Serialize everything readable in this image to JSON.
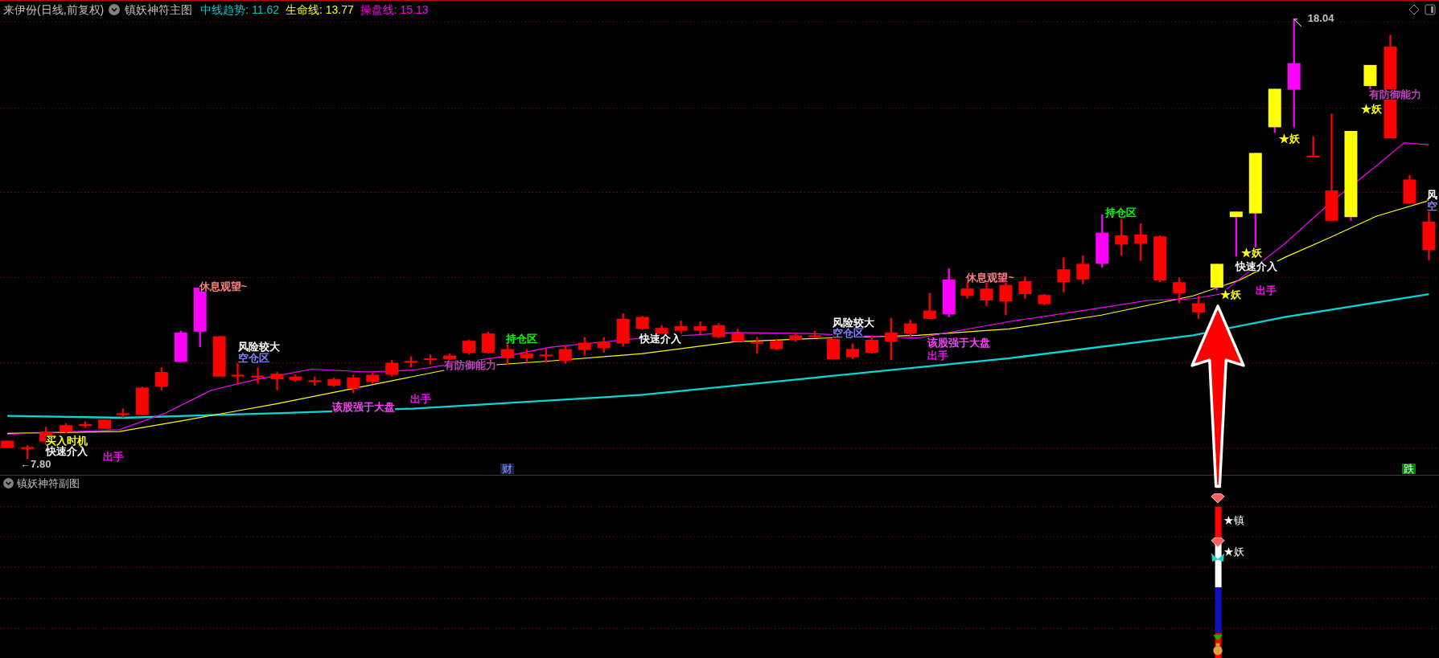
{
  "header": {
    "stock": "来伊份(日线,前复权)",
    "indicator": "镇妖神符主图",
    "values": [
      {
        "text": "中线趋势: 11.62",
        "color": "#00c8c8"
      },
      {
        "text": "生命线: 13.77",
        "color": "#ffff00"
      },
      {
        "text": "操盘线: 15.13",
        "color": "#ff00ff"
      }
    ]
  },
  "main_chart": {
    "annotations": [
      {
        "text": "18.04",
        "color": "#c0c0c0"
      },
      {
        "text": "休息观望~",
        "color": "#ff8080"
      },
      {
        "text": "风险较大",
        "color": "#ffffff"
      },
      {
        "text": "空仓区",
        "color": "#8080ff"
      },
      {
        "text": "有防御能力",
        "color": "#c040c0"
      },
      {
        "text": "持仓区",
        "color": "#00ff00"
      },
      {
        "text": "快速介入",
        "color": "#ffffff"
      },
      {
        "text": "风险较大",
        "color": "#ffffff"
      },
      {
        "text": "空仓区",
        "color": "#8080ff"
      },
      {
        "text": "休息观望~",
        "color": "#ff8080"
      },
      {
        "text": "该股强于大盘",
        "color": "#ff40ff"
      },
      {
        "text": "出手",
        "color": "#ff00ff"
      },
      {
        "text": "持仓区",
        "color": "#00ff00"
      },
      {
        "text": "★妖",
        "color": "#ffff00"
      },
      {
        "text": "快速介入",
        "color": "#ffffff"
      },
      {
        "text": "★妖",
        "color": "#ffff00"
      },
      {
        "text": "出手",
        "color": "#ff00ff"
      },
      {
        "text": "★妖",
        "color": "#ffff00"
      },
      {
        "text": "有防御能力",
        "color": "#c040c0"
      },
      {
        "text": "★妖",
        "color": "#ffff00"
      },
      {
        "text": "风",
        "color": "#ffffff"
      },
      {
        "text": "空",
        "color": "#8080ff"
      },
      {
        "text": "该股强于大盘",
        "color": "#ff40ff"
      },
      {
        "text": "出手",
        "color": "#ff00ff"
      },
      {
        "text": "买入时机",
        "color": "#ffff00"
      },
      {
        "text": "快速介入",
        "color": "#ffffff"
      },
      {
        "text": "←7.80",
        "color": "#c0c0c0"
      },
      {
        "text": "出手",
        "color": "#ff00ff"
      }
    ],
    "bottom_markers": [
      {
        "text": "财",
        "kind": "wealth"
      },
      {
        "text": "跌",
        "kind": "fall"
      }
    ]
  },
  "sub_chart": {
    "title": "镇妖神符副图",
    "annotations": [
      {
        "text": "★镇"
      },
      {
        "text": "★妖"
      }
    ]
  }
}
